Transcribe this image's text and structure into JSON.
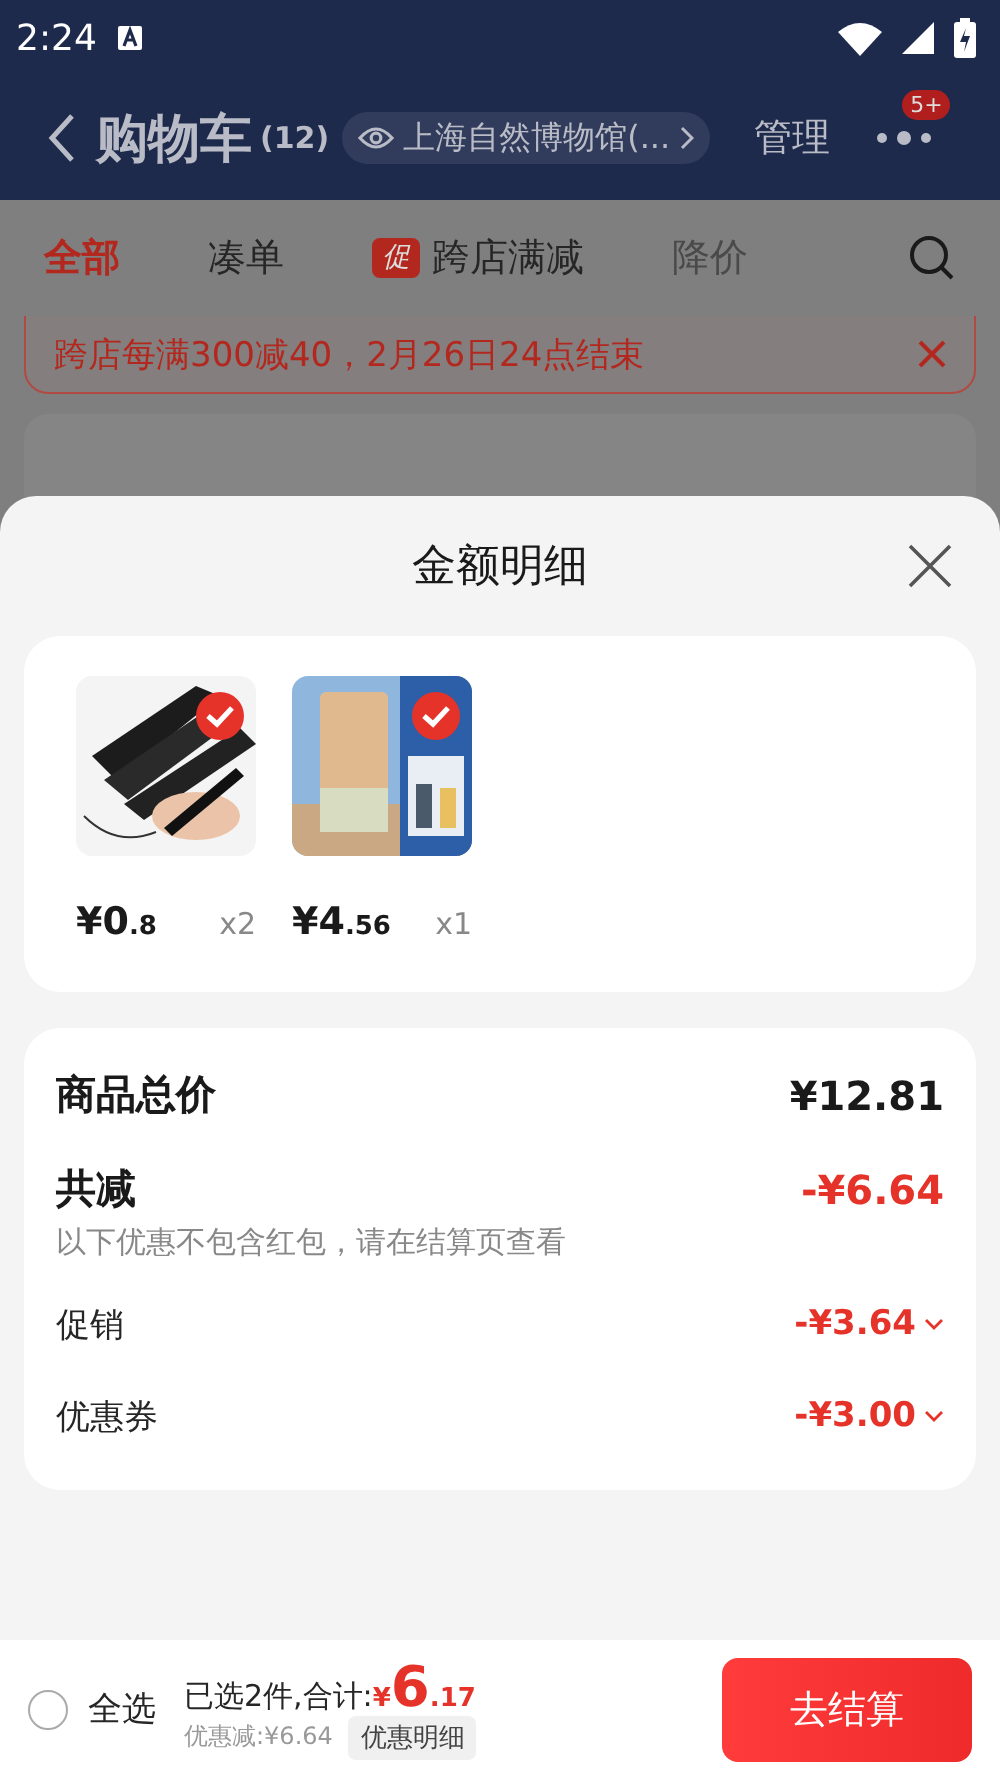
{
  "status_bar": {
    "time": "2:24"
  },
  "header": {
    "title": "购物车",
    "count": "(12)",
    "location": "上海自然博物馆(...",
    "manage": "管理",
    "badge": "5+"
  },
  "filter_tabs": [
    {
      "label": "全部",
      "selected": true,
      "disabled": false
    },
    {
      "label": "凑单",
      "selected": false,
      "disabled": false
    },
    {
      "label": "跨店满减",
      "selected": false,
      "disabled": false,
      "tag": "促"
    },
    {
      "label": "降价",
      "selected": false,
      "disabled": true
    }
  ],
  "promo_banner": {
    "text": "跨店每满300减40，2月26日24点结束"
  },
  "sheet": {
    "title": "金额明细",
    "items": [
      {
        "kind": "pens",
        "price": "¥0",
        "price_decimal": ".8",
        "quantity": "x2",
        "checked": true
      },
      {
        "kind": "pencils",
        "price": "¥4",
        "price_decimal": ".56",
        "quantity": "x1",
        "checked": true
      }
    ],
    "total": {
      "label": "商品总价",
      "value": "¥12.81"
    },
    "reduction": {
      "label": "共减",
      "value": "-¥6.64",
      "note": "以下优惠不包含红包，请在结算页查看"
    },
    "details": [
      {
        "label": "促销",
        "value": "-¥3.64"
      },
      {
        "label": "优惠券",
        "value": "-¥3.00"
      }
    ]
  },
  "footer": {
    "select_all": {
      "label": "全选",
      "checked": false
    },
    "summary": "已选2件,合计:",
    "currency": "¥",
    "total": "6",
    "total_decimal": ".17",
    "discount": "优惠减:¥6.64",
    "detail_button": "优惠明细",
    "checkout": "去结算"
  }
}
